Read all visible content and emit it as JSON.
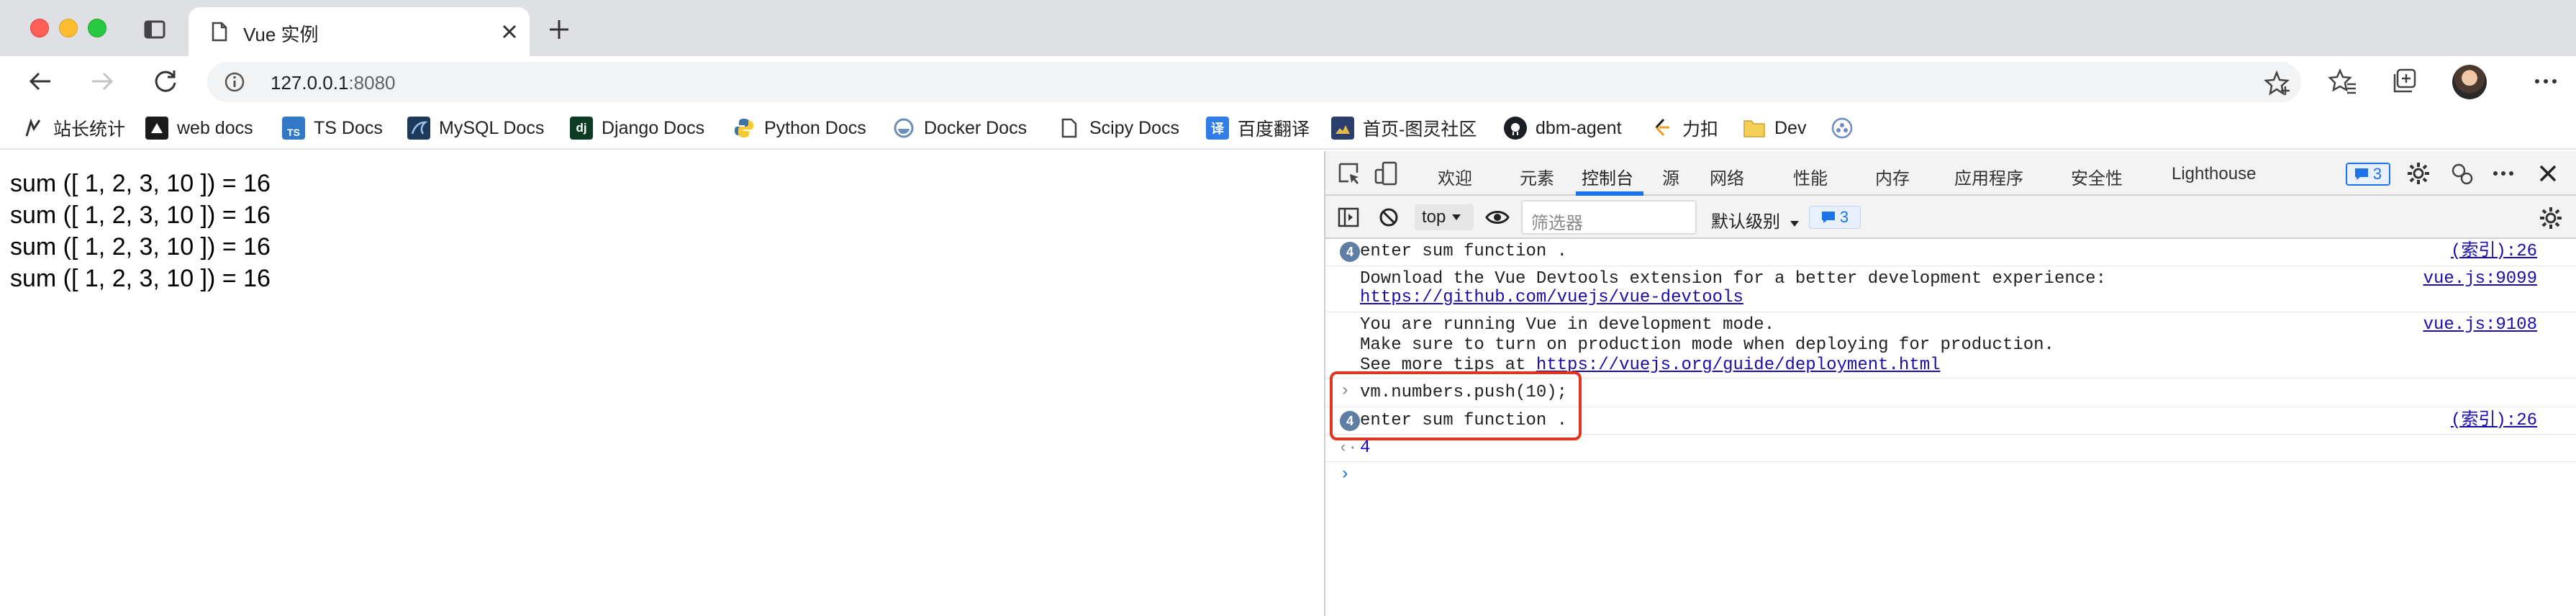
{
  "browser": {
    "tab": {
      "title": "Vue 实例"
    },
    "address": {
      "host": "127.0.0.1",
      "port": ":8080"
    },
    "bookmarks": [
      {
        "label": "站长统计",
        "icon": "stats-icon"
      },
      {
        "label": "web docs",
        "icon": "mdn-icon"
      },
      {
        "label": "TS Docs",
        "icon": "ts-icon"
      },
      {
        "label": "MySQL Docs",
        "icon": "mysql-icon"
      },
      {
        "label": "Django Docs",
        "icon": "django-icon"
      },
      {
        "label": "Python Docs",
        "icon": "python-icon"
      },
      {
        "label": "Docker Docs",
        "icon": "docker-icon"
      },
      {
        "label": "Scipy Docs",
        "icon": "page-icon"
      },
      {
        "label": "百度翻译",
        "icon": "translate-icon"
      },
      {
        "label": "首页-图灵社区",
        "icon": "turing-icon"
      },
      {
        "label": "dbm-agent",
        "icon": "github-icon"
      },
      {
        "label": "力扣",
        "icon": "leetcode-icon"
      },
      {
        "label": "Dev",
        "icon": "folder-icon"
      }
    ]
  },
  "page": {
    "lines": [
      "sum ([ 1, 2, 3, 10 ]) = 16",
      "sum ([ 1, 2, 3, 10 ]) = 16",
      "sum ([ 1, 2, 3, 10 ]) = 16",
      "sum ([ 1, 2, 3, 10 ]) = 16"
    ]
  },
  "devtools": {
    "tabs": {
      "welcome": "欢迎",
      "elements": "元素",
      "console": "控制台",
      "sources": "源",
      "network": "网络",
      "performance": "性能",
      "memory": "内存",
      "application": "应用程序",
      "security": "安全性",
      "lighthouse": "Lighthouse"
    },
    "issues_count": "3",
    "filterbar": {
      "context": "top",
      "filter_placeholder": "筛选器",
      "level": "默认级别",
      "issues_count": "3"
    },
    "console": {
      "messages": [
        {
          "count": "4",
          "text": "enter sum function .",
          "source": "(索引):26"
        },
        {
          "text_1": "Download the Vue Devtools extension for a better development experience:",
          "link": "https://github.com/vuejs/vue-devtools",
          "source": "vue.js:9099"
        },
        {
          "text_1": "You are running Vue in development mode.",
          "text_2": "Make sure to turn on production mode when deploying for production.",
          "text_3_prefix": "See more tips at ",
          "link": "https://vuejs.org/guide/deployment.html",
          "source": "vue.js:9108"
        },
        {
          "input": "vm.numbers.push(10);"
        },
        {
          "count": "4",
          "text": "enter sum function .",
          "source": "(索引):26"
        },
        {
          "result": "4"
        }
      ]
    }
  },
  "colors": {
    "accent": "#1a73e8",
    "highlight": "#e0341e",
    "link": "#1a0dab"
  }
}
